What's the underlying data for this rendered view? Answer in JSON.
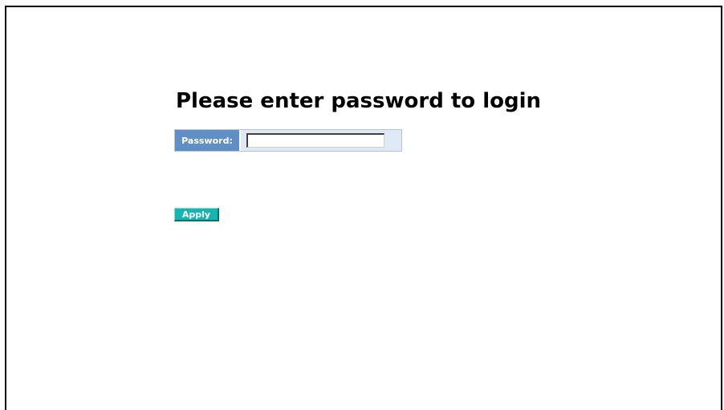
{
  "page": {
    "title": "Please enter password to login"
  },
  "form": {
    "password_label": "Password:",
    "password_value": "",
    "apply_label": "Apply"
  },
  "colors": {
    "label_background": "#5f8fc4",
    "field_background": "#dfe8f5",
    "button_background": "#18b4b0",
    "frame_border": "#000000"
  }
}
